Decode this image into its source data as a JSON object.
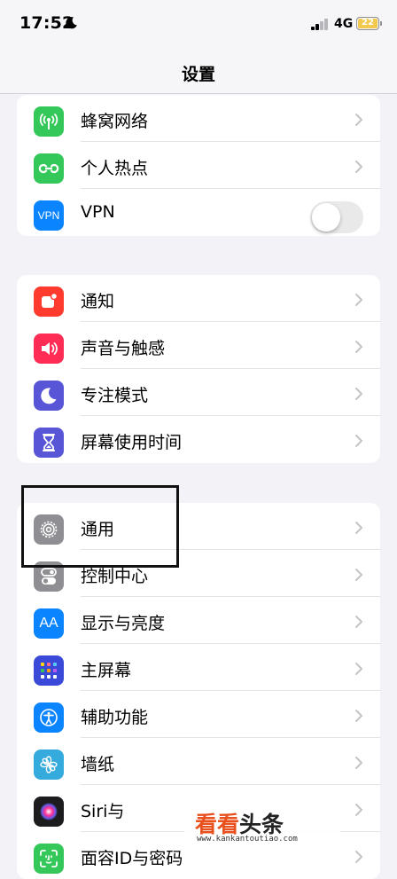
{
  "status": {
    "time": "17:52",
    "network": "4G",
    "battery": "22"
  },
  "nav": {
    "title": "设置"
  },
  "groups": [
    {
      "items": [
        {
          "label": "蜂窝网络",
          "icon": "cellular-antenna-icon",
          "color": "#34c759",
          "accessory": "chevron"
        },
        {
          "label": "个人热点",
          "icon": "hotspot-link-icon",
          "color": "#34c759",
          "accessory": "chevron"
        },
        {
          "label": "VPN",
          "icon": "vpn-icon",
          "icon_text": "VPN",
          "color": "#0a84ff",
          "accessory": "toggle",
          "toggle_on": false
        }
      ]
    },
    {
      "items": [
        {
          "label": "通知",
          "icon": "notification-bell-icon",
          "color": "#ff3b30",
          "accessory": "chevron"
        },
        {
          "label": "声音与触感",
          "icon": "speaker-icon",
          "color": "#ff2d55",
          "accessory": "chevron"
        },
        {
          "label": "专注模式",
          "icon": "moon-icon",
          "color": "#5856d6",
          "accessory": "chevron"
        },
        {
          "label": "屏幕使用时间",
          "icon": "hourglass-icon",
          "color": "#5856d6",
          "accessory": "chevron"
        }
      ]
    },
    {
      "items": [
        {
          "label": "通用",
          "icon": "gear-icon",
          "color": "#8e8e93",
          "accessory": "chevron"
        },
        {
          "label": "控制中心",
          "icon": "toggles-icon",
          "color": "#8e8e93",
          "accessory": "chevron"
        },
        {
          "label": "显示与亮度",
          "icon": "text-size-icon",
          "icon_text": "AA",
          "color": "#0a84ff",
          "accessory": "chevron"
        },
        {
          "label": "主屏幕",
          "icon": "app-grid-icon",
          "color": "#3a49d8",
          "accessory": "chevron"
        },
        {
          "label": "辅助功能",
          "icon": "accessibility-icon",
          "color": "#0a84ff",
          "accessory": "chevron"
        },
        {
          "label": "墙纸",
          "icon": "flower-icon",
          "color": "#35aadc",
          "accessory": "chevron"
        },
        {
          "label": "Siri与",
          "icon": "siri-icon",
          "color": "#1c1c1e",
          "accessory": "chevron"
        },
        {
          "label": "面容ID与密码",
          "icon": "face-id-icon",
          "color": "#34c759",
          "accessory": "chevron"
        }
      ]
    }
  ],
  "watermark": {
    "main_orange": "看看",
    "main_dark": "头条",
    "url": "www.kankantoutiao.com"
  }
}
